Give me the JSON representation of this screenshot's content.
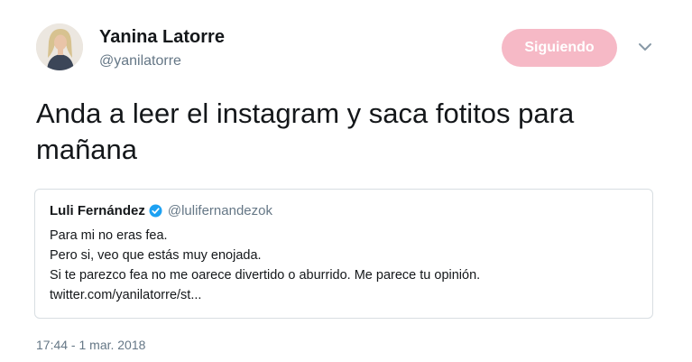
{
  "author": {
    "name": "Yanina Latorre",
    "handle": "@yanilatorre",
    "avatar_icon": "avatar-photo"
  },
  "follow_button": {
    "label": "Siguiendo",
    "color": "#f6b9c6"
  },
  "menu": {
    "icon": "chevron-down-icon"
  },
  "tweet": {
    "text": "Anda a leer el instagram y saca fotitos para mañana"
  },
  "quoted_tweet": {
    "name": "Luli Fernández",
    "verified_icon": "verified-badge-icon",
    "handle": "@lulifernandezok",
    "lines": [
      "Para mi no eras fea.",
      "Pero si, veo que estás muy enojada.",
      "Si te parezco fea no me oarece divertido o aburrido. Me parece tu opinión.",
      "twitter.com/yanilatorre/st..."
    ]
  },
  "timestamp": "17:44 - 1 mar. 2018",
  "colors": {
    "text": "#14171a",
    "secondary": "#657786",
    "verified": "#1da1f2",
    "border": "#d8dee2"
  }
}
